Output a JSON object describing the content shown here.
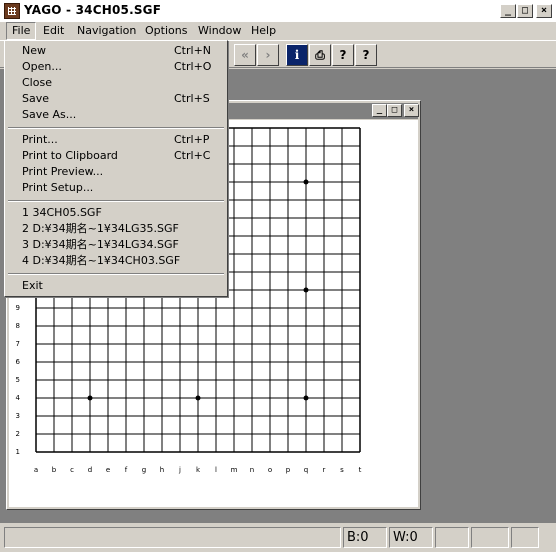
{
  "app": {
    "title": "YAGO - 34CH05.SGF",
    "window_buttons": {
      "minimize": "_",
      "maximize": "□",
      "close": "×"
    }
  },
  "menubar": [
    "File",
    "Edit",
    "Navigation",
    "Options",
    "Window",
    "Help"
  ],
  "toolbar": {
    "buttons": [
      {
        "name": "prev-double-button",
        "glyph": "«"
      },
      {
        "name": "prev-button",
        "glyph": "›"
      },
      {
        "name": "info-button",
        "glyph": "i"
      },
      {
        "name": "print-button",
        "glyph": "⎙"
      },
      {
        "name": "help-button",
        "glyph": "?"
      },
      {
        "name": "context-help-button",
        "glyph": "?"
      }
    ]
  },
  "file_menu": {
    "items": [
      {
        "label": "New",
        "shortcut": "Ctrl+N"
      },
      {
        "label": "Open...",
        "shortcut": "Ctrl+O"
      },
      {
        "label": "Close",
        "shortcut": ""
      },
      {
        "label": "Save",
        "shortcut": "Ctrl+S"
      },
      {
        "label": "Save As...",
        "shortcut": ""
      },
      {
        "label": "Print...",
        "shortcut": "Ctrl+P"
      },
      {
        "label": "Print to Clipboard",
        "shortcut": "Ctrl+C"
      },
      {
        "label": "Print Preview...",
        "shortcut": ""
      },
      {
        "label": "Print Setup...",
        "shortcut": ""
      },
      {
        "label": "1 34CH05.SGF",
        "shortcut": ""
      },
      {
        "label": "2 D:¥34期名~1¥34LG35.SGF",
        "shortcut": ""
      },
      {
        "label": "3 D:¥34期名~1¥34LG34.SGF",
        "shortcut": ""
      },
      {
        "label": "4 D:¥34期名~1¥34CH03.SGF",
        "shortcut": ""
      },
      {
        "label": "Exit",
        "shortcut": ""
      }
    ]
  },
  "board": {
    "columns": [
      "a",
      "b",
      "c",
      "d",
      "e",
      "f",
      "g",
      "h",
      "j",
      "k",
      "l",
      "m",
      "n",
      "o",
      "p",
      "q",
      "r",
      "s",
      "t"
    ],
    "visible_rows": [
      "9",
      "8",
      "7",
      "6",
      "5",
      "4",
      "3",
      "2",
      "1"
    ],
    "hoshi_points": [
      "d4",
      "k4",
      "q4",
      "q10",
      "q16"
    ]
  },
  "status": {
    "black_captures": "B:0",
    "white_captures": "W:0"
  }
}
